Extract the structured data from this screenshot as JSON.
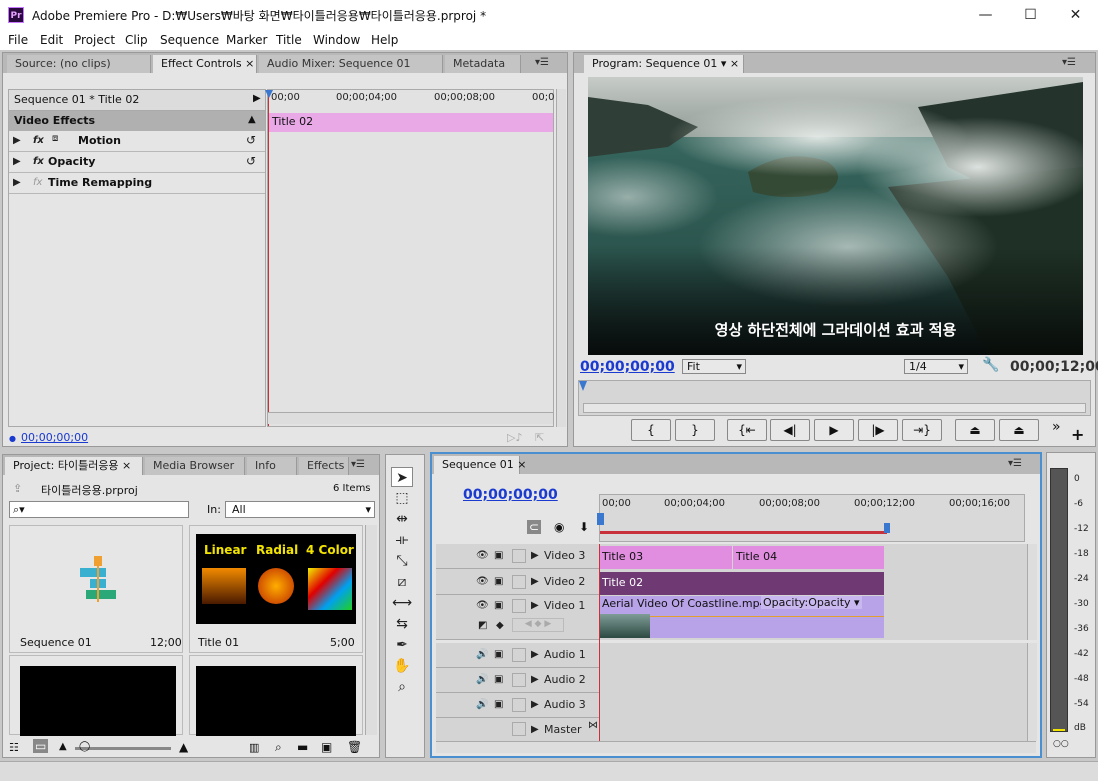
{
  "app": {
    "title": "Adobe Premiere Pro - D:₩Users₩바탕 화면₩타이틀러응용₩타이틀러응용.prproj *",
    "icon_label": "Pr"
  },
  "menu": [
    "File",
    "Edit",
    "Project",
    "Clip",
    "Sequence",
    "Marker",
    "Title",
    "Window",
    "Help"
  ],
  "source_panel": {
    "tabs": [
      "Source: (no clips)",
      "Effect Controls",
      "Audio Mixer: Sequence 01",
      "Metadata"
    ],
    "sequence_label": "Sequence 01 * Title 02",
    "timeline_ticks": [
      "00;00",
      "00;00;04;00",
      "00;00;08;00",
      "00;0"
    ],
    "clip_bar": "Title 02",
    "section": "Video Effects",
    "effects": [
      "Motion",
      "Opacity",
      "Time Remapping"
    ],
    "timecode": "00;00;00;00"
  },
  "program_panel": {
    "tab": "Program: Sequence 01",
    "subtitle": "영상 하단전체에 그라데이션 효과 적용",
    "timecode_left": "00;00;00;00",
    "fit": "Fit",
    "quality": "1/4",
    "timecode_right": "00;00;12;00"
  },
  "project_panel": {
    "tabs": [
      "Project: 타이틀러응용",
      "Media Browser",
      "Info",
      "Effects"
    ],
    "project_file": "타이틀러응용.prproj",
    "item_count": "6 Items",
    "in_label": "In:",
    "in_value": "All",
    "items": [
      {
        "name": "Sequence 01",
        "duration": "12;00"
      },
      {
        "name": "Title 01",
        "duration": "5;00"
      }
    ],
    "title01_labels": [
      "Linear",
      "Radial",
      "4 Color"
    ]
  },
  "sequence_panel": {
    "tab": "Sequence 01",
    "timecode": "00;00;00;00",
    "ruler": [
      "00;00",
      "00;00;04;00",
      "00;00;08;00",
      "00;00;12;00",
      "00;00;16;00"
    ],
    "video_tracks": [
      "Video 3",
      "Video 2",
      "Video 1"
    ],
    "audio_tracks": [
      "Audio 1",
      "Audio 2",
      "Audio 3"
    ],
    "master": "Master",
    "clips": {
      "title03": "Title 03",
      "title04": "Title 04",
      "title02": "Title 02",
      "video": "Aerial Video Of Coastline.mp4",
      "opacity": "Opacity:Opacity"
    }
  },
  "meter": {
    "labels": [
      "0",
      "-6",
      "-12",
      "-18",
      "-24",
      "-30",
      "-36",
      "-42",
      "-48",
      "-54",
      "dB"
    ]
  },
  "colors": {
    "accent_blue": "#1a3ad0",
    "clip_pink": "#e18ee0",
    "clip_purple": "#6f3a73",
    "clip_lavender": "#b8a2e8",
    "playhead": "#c8303a"
  }
}
